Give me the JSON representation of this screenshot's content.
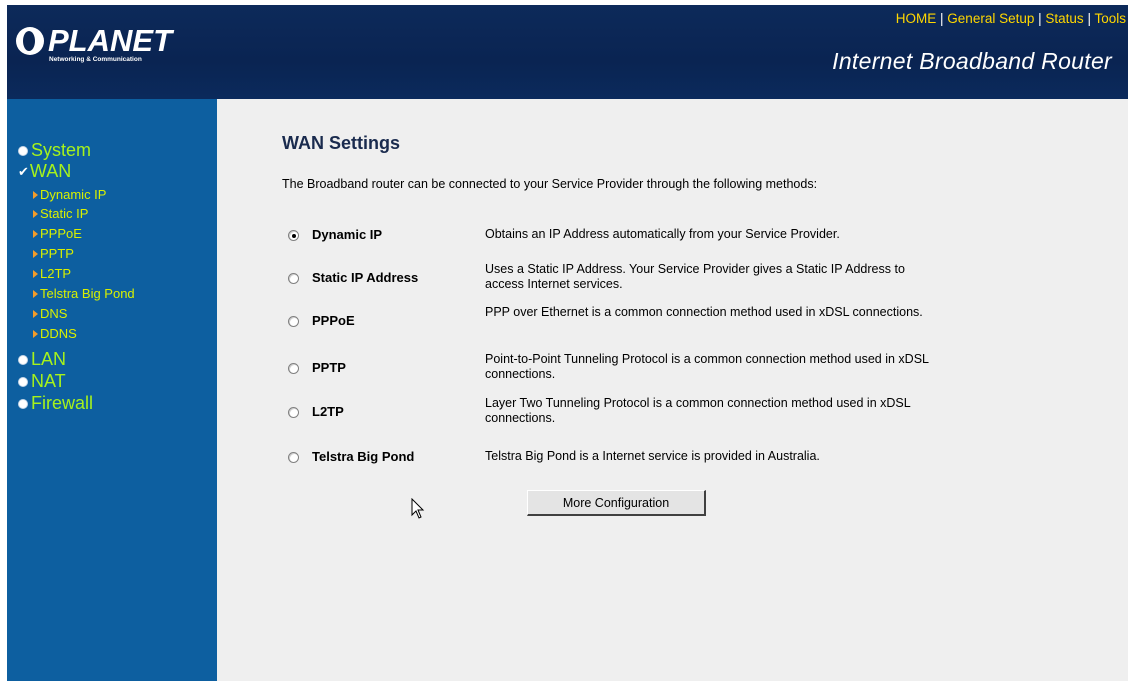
{
  "header": {
    "brand": "PLANET",
    "tagline": "Networking & Communication",
    "nav_links": [
      "HOME",
      "General Setup",
      "Status",
      "Tools"
    ],
    "separator": "|",
    "product_title": "Internet Broadband Router"
  },
  "sidebar": {
    "system": "System",
    "wan": "WAN",
    "wan_sub": [
      "Dynamic IP",
      "Static IP",
      "PPPoE",
      "PPTP",
      "L2TP",
      "Telstra Big Pond",
      "DNS",
      "DDNS"
    ],
    "lan": "LAN",
    "nat": "NAT",
    "firewall": "Firewall"
  },
  "main": {
    "title": "WAN Settings",
    "intro": "The Broadband router can be connected to your Service Provider through the following methods:",
    "options": [
      {
        "label": "Dynamic IP",
        "desc": "Obtains an IP Address automatically from your Service Provider.",
        "checked": true
      },
      {
        "label": "Static IP Address",
        "desc": "Uses a Static IP Address. Your Service Provider gives a Static IP Address to access Internet services.",
        "checked": false
      },
      {
        "label": "PPPoE",
        "desc": "PPP over Ethernet is a common connection method used in xDSL connections.",
        "checked": false
      },
      {
        "label": "PPTP",
        "desc": "Point-to-Point Tunneling Protocol is a common connection method used in xDSL connections.",
        "checked": false
      },
      {
        "label": "L2TP",
        "desc": "Layer Two Tunneling Protocol is a common connection method used in xDSL connections.",
        "checked": false
      },
      {
        "label": "Telstra Big Pond",
        "desc": "Telstra Big Pond is a Internet service is provided in Australia.",
        "checked": false
      }
    ],
    "button": "More Configuration"
  },
  "colors": {
    "header_bg": "#0b2550",
    "sidebar_bg": "#0d5fa0",
    "content_bg": "#efefef",
    "nav_link": "#ffd700",
    "menu_text": "#a6f21c"
  }
}
